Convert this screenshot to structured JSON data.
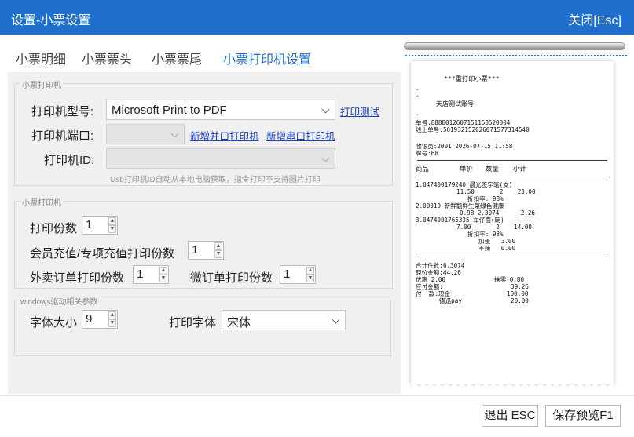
{
  "window": {
    "title": "设置-小票设置",
    "close_label": "关闭[Esc]"
  },
  "tabs": [
    "小票明细",
    "小票票头",
    "小票票尾",
    "小票打印机设置"
  ],
  "printer_group": {
    "label": "小票打印机",
    "model_label": "打印机型号:",
    "model_value": "Microsoft Print to PDF",
    "print_test": "打印测试",
    "port_label": "打印机端口:",
    "port_value": "",
    "add_parallel": "新增并口打印机",
    "add_serial": "新增串口打印机",
    "id_label": "打印机ID:",
    "id_value": "",
    "id_hint": "Usb打印机ID自动从本地电脑获取，指令打印不支持图片打印"
  },
  "copies_group": {
    "label": "小票打印机",
    "copies_label": "打印份数",
    "copies_value": "1",
    "member_label": "会员充值/专项充值打印份数",
    "member_value": "1",
    "takeout_label": "外卖订单打印份数",
    "takeout_value": "1",
    "wechat_label": "微订单打印份数",
    "wechat_value": "1"
  },
  "windows_group": {
    "label": "windows驱动相关参数",
    "font_size_label": "字体大小",
    "font_size_value": "9",
    "font_label": "打印字体",
    "font_value": "宋体"
  },
  "receipt": {
    "reprint_title": "***重打印小票***",
    "store": "天店测试账号",
    "order_no": "单号:8888012607151158520004",
    "online_no": "线上单号:561932152026071577314540",
    "cashier": "收银员:2001 2026-07-15 11:58",
    "table_no": "牌号:68",
    "headers": [
      "商品",
      "单价",
      "数量",
      "小计"
    ],
    "items": [
      "1.047400179240 晨光签字笔(支)",
      "11.50       2    23.00",
      "折扣率: 98%",
      "2.00010 新鲜鹅鲜生菜绿色健康",
      "0.98 2.3074      2.26",
      "3.0474001765335 车仔面(碗)",
      "7.00       2    14.00",
      "折扣率: 93%",
      "加蛋   3.00",
      "不辣   0.00"
    ],
    "total_qty": "合计件数:6.3074",
    "original_total": "原价金额:44.26",
    "discount": "优惠 2.00",
    "rounding": "抹零:0.80",
    "payable_label": "应付金额:",
    "payable_value": "39.26",
    "payment_label": "付  款:现金",
    "payment_value": "100.00",
    "pay2_label": "德迅pay",
    "pay2_value": "20.00"
  },
  "footer": {
    "exit_label": "退出 ESC",
    "save_label": "保存预览F1"
  }
}
